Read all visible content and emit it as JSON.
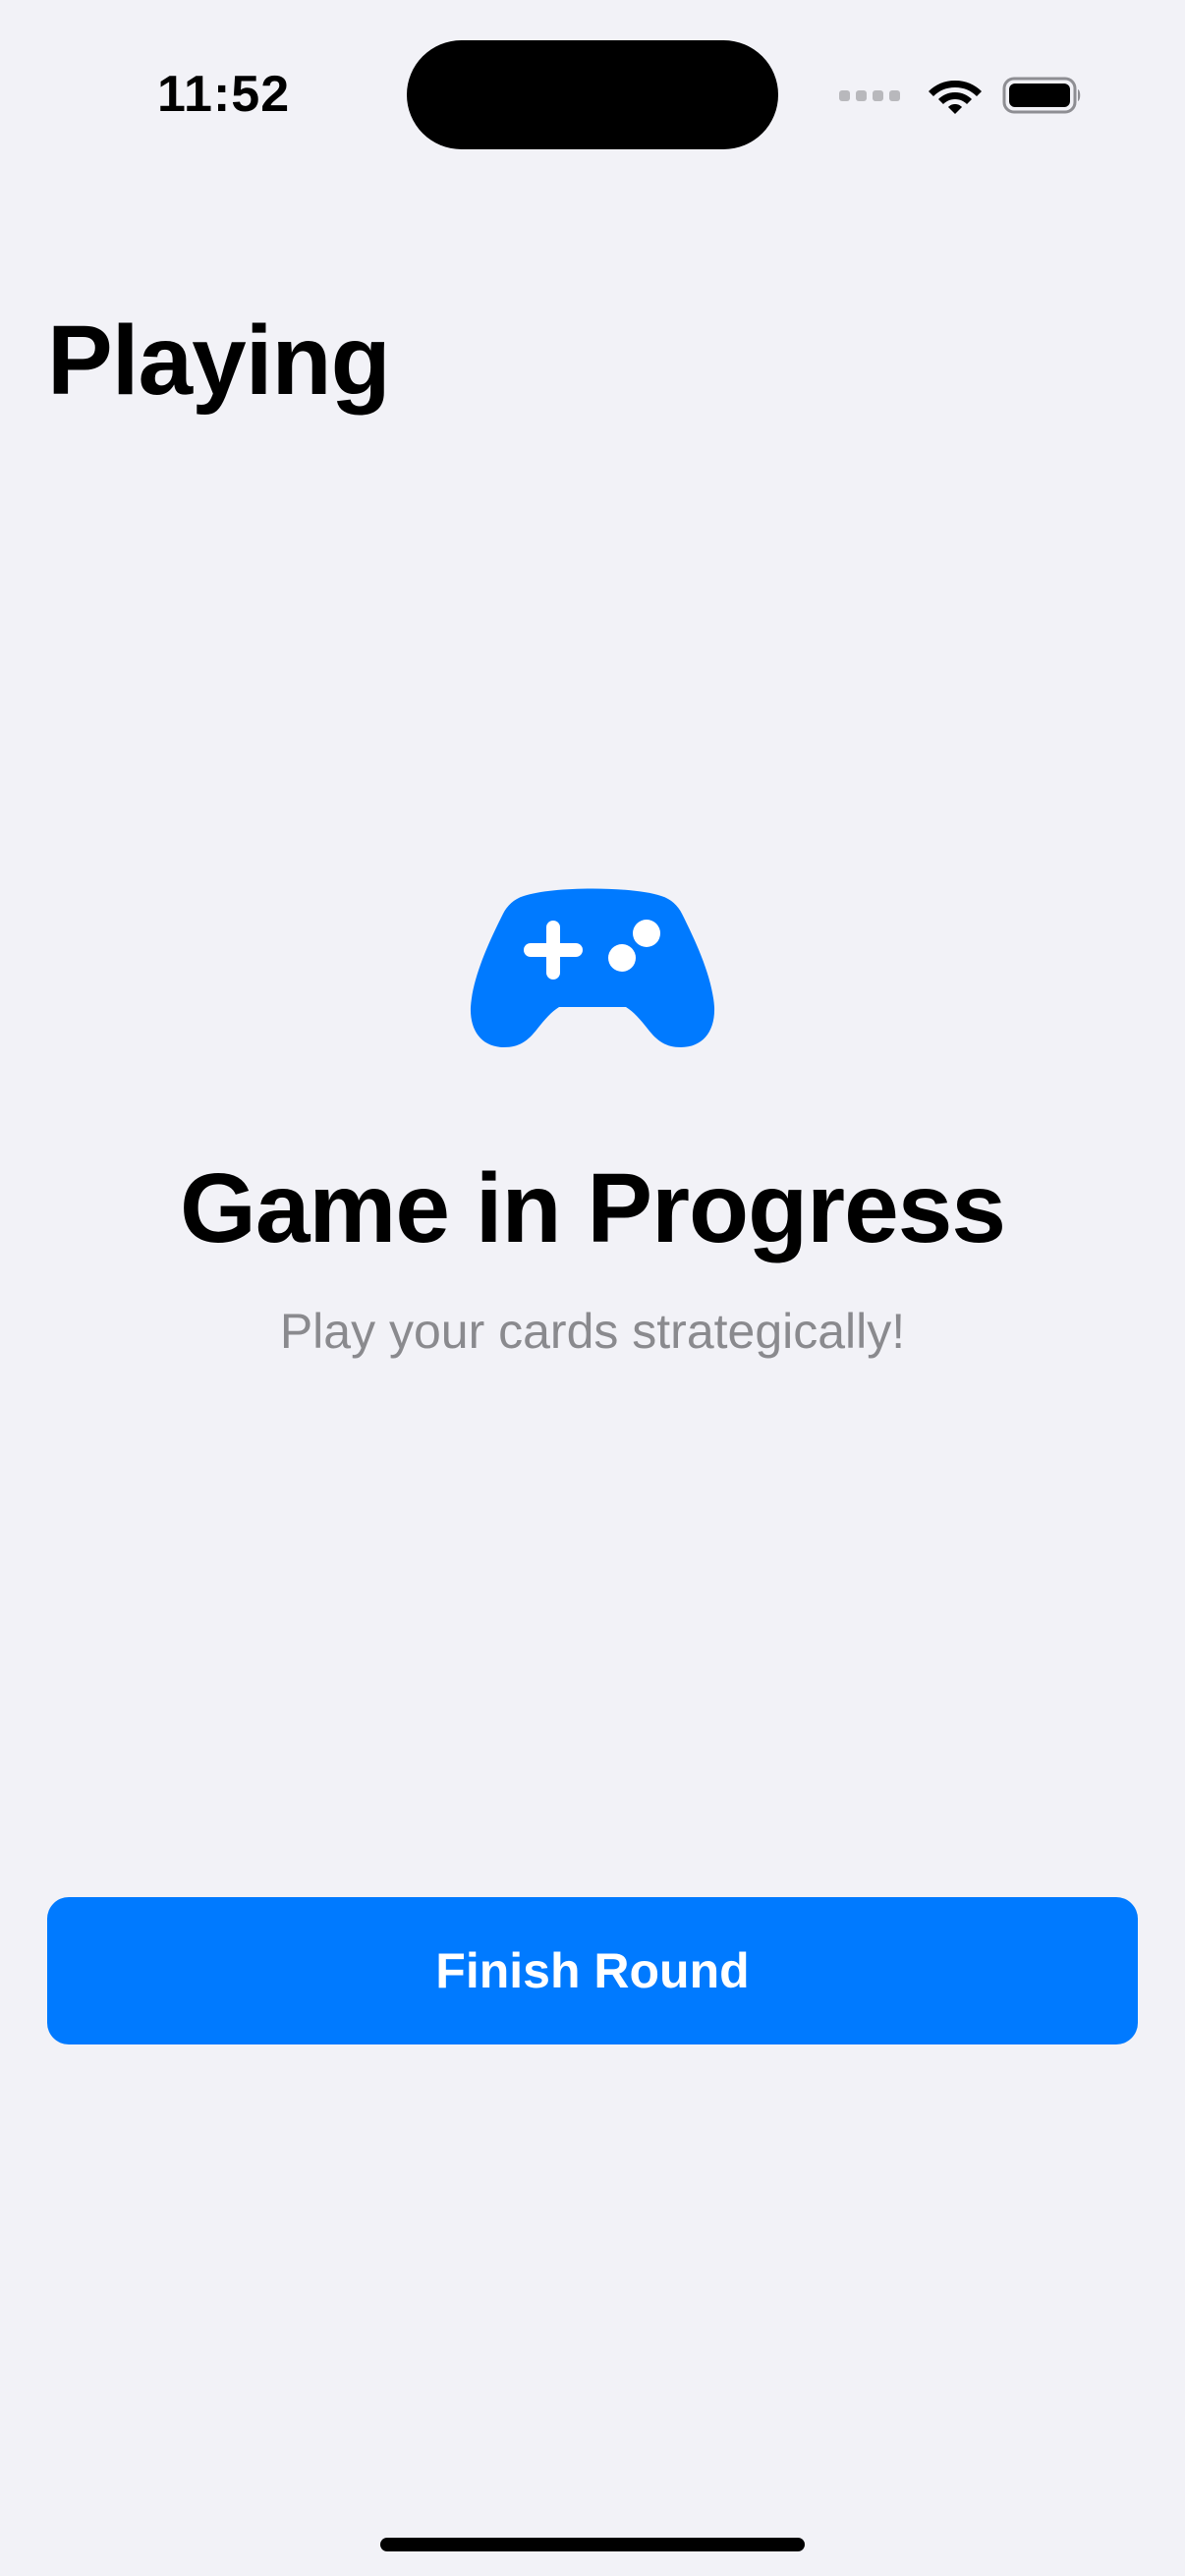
{
  "status_bar": {
    "time": "11:52",
    "icons": [
      "cellular-signal-icon",
      "wifi-icon",
      "battery-icon"
    ]
  },
  "page": {
    "title": "Playing"
  },
  "hero": {
    "icon": "gamecontroller-icon",
    "title": "Game in Progress",
    "subtitle": "Play your cards strategically!"
  },
  "actions": {
    "finish_label": "Finish Round"
  },
  "colors": {
    "background": "#f2f2f7",
    "accent": "#007aff",
    "secondary_text": "#8a8a8e"
  }
}
